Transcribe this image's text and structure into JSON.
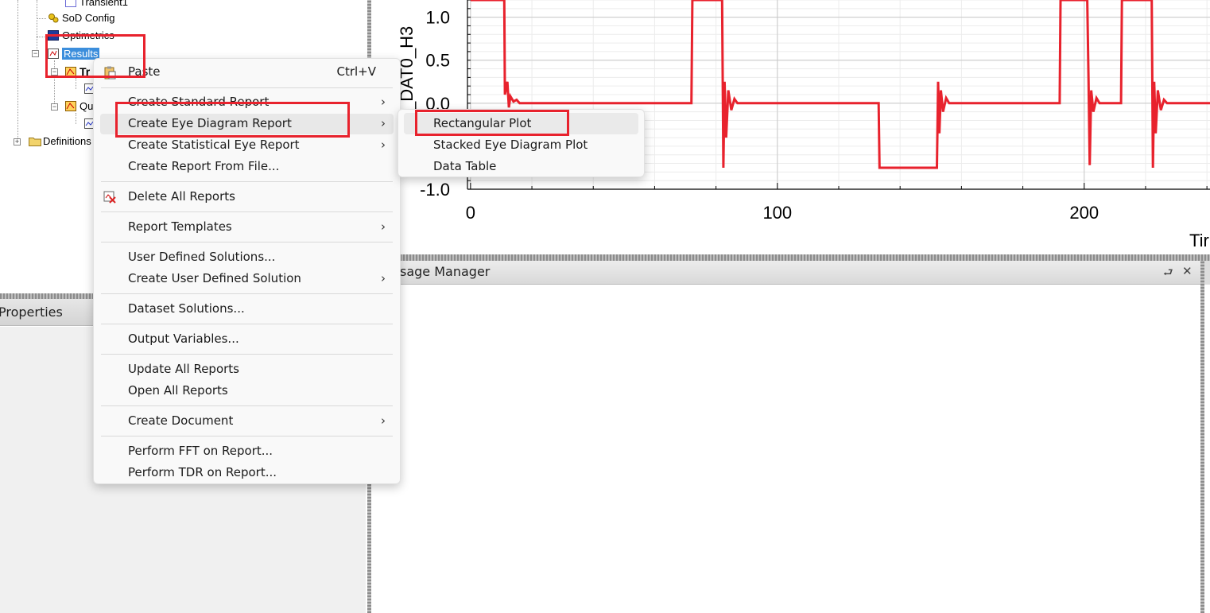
{
  "tree": {
    "items": [
      {
        "label": "Transient1"
      },
      {
        "label": "SoD Config"
      },
      {
        "label": "Optimetrics"
      },
      {
        "label": "Results"
      },
      {
        "label": "Tr"
      },
      {
        "label": "Qu"
      },
      {
        "label": "Definitions"
      }
    ]
  },
  "properties": {
    "title": "Properties"
  },
  "message_manager": {
    "title": "sage Manager",
    "pin_glyph": "⮐",
    "close_glyph": "✕"
  },
  "plot": {
    "ylabel": "_DAT0_H3",
    "xlabel": "Tir",
    "y_ticks": [
      "1.0",
      "0.5",
      "0.0",
      "-1.0"
    ],
    "x_ticks": [
      "0",
      "100",
      "200"
    ],
    "line_color": "#e8222d"
  },
  "context_menu": {
    "paste": {
      "label": "Paste",
      "shortcut": "Ctrl+V"
    },
    "create_standard_report": "Create Standard Report",
    "create_eye_diagram_report": "Create Eye Diagram Report",
    "create_statistical_eye_report": "Create Statistical Eye Report",
    "create_report_from_file": "Create Report From File...",
    "delete_all_reports": "Delete All Reports",
    "report_templates": "Report Templates",
    "user_defined_solutions": "User Defined Solutions...",
    "create_user_defined_solution": "Create User Defined Solution",
    "dataset_solutions": "Dataset Solutions...",
    "output_variables": "Output Variables...",
    "update_all_reports": "Update All Reports",
    "open_all_reports": "Open All Reports",
    "create_document": "Create Document",
    "perform_fft": "Perform FFT on Report...",
    "perform_tdr": "Perform TDR on Report...",
    "arrow_glyph": "›"
  },
  "submenu": {
    "rectangular_plot": "Rectangular Plot",
    "stacked_eye_diagram_plot": "Stacked Eye Diagram Plot",
    "data_table": "Data Table"
  },
  "chart_data": {
    "type": "line",
    "title": "",
    "xlabel": "Tir",
    "ylabel": "_DAT0_H3",
    "xlim": [
      -1,
      241
    ],
    "ylim": [
      -1.0,
      1.2
    ],
    "x_ticks": [
      0,
      100,
      200
    ],
    "y_ticks": [
      1.0,
      0.5,
      0.0,
      -1.0
    ],
    "grid": true,
    "series": [
      {
        "x": [
          0,
          11,
          11.2,
          12,
          12.5,
          13,
          14,
          15,
          16,
          72,
          72.3,
          82,
          82.4,
          82.8,
          83.3,
          84,
          85,
          86,
          87,
          133,
          133.3,
          152,
          152.4,
          152.8,
          153.3,
          154,
          155,
          156,
          157,
          192,
          192.3,
          201,
          201.4,
          201.8,
          202.3,
          203,
          204,
          205,
          206,
          212,
          212.3,
          222,
          222.4,
          222.8,
          223.3,
          224,
          225,
          226,
          227,
          241
        ],
        "y": [
          1.2,
          1.2,
          0.1,
          0.25,
          -0.05,
          0.08,
          0.02,
          0.04,
          0.0,
          0.0,
          1.2,
          1.2,
          -0.75,
          0.25,
          -0.4,
          0.15,
          -0.08,
          0.05,
          0.0,
          0.0,
          -0.75,
          -0.75,
          0.25,
          -0.35,
          0.15,
          -0.1,
          0.06,
          0.0,
          0.0,
          0.0,
          1.2,
          1.2,
          0.28,
          -0.72,
          0.15,
          -0.1,
          0.06,
          0.0,
          0.0,
          0.0,
          1.2,
          1.2,
          -0.75,
          0.25,
          -0.35,
          0.15,
          -0.08,
          0.04,
          0.0,
          0.0
        ]
      }
    ]
  }
}
